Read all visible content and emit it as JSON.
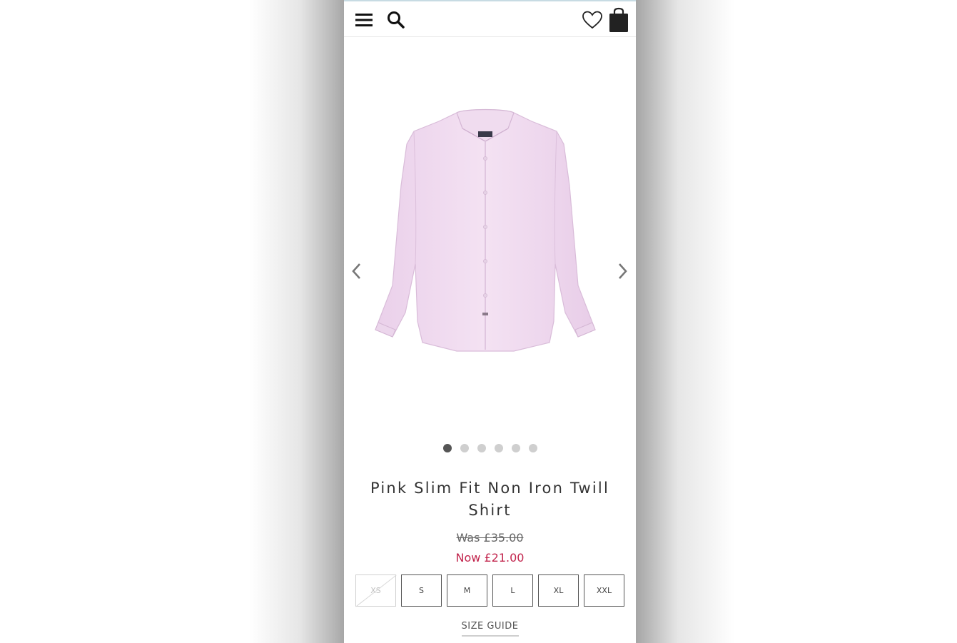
{
  "header": {
    "menu_icon": "hamburger-menu-icon",
    "search_icon": "search-icon",
    "wishlist_icon": "heart-icon",
    "bag_icon": "shopping-bag-icon"
  },
  "gallery": {
    "image_alt": "",
    "slide_count": 6,
    "active_slide": 1,
    "shirt_color": "#f1dcf1",
    "prev_icon": "chevron-left-icon",
    "next_icon": "chevron-right-icon"
  },
  "product": {
    "title": "Pink Slim Fit Non Iron Twill Shirt",
    "was_price": "Was £35.00",
    "now_price": "Now £21.00",
    "price_accent": "#c2254d"
  },
  "sizes": [
    {
      "label": "XS",
      "available": false
    },
    {
      "label": "S",
      "available": true
    },
    {
      "label": "M",
      "available": true
    },
    {
      "label": "L",
      "available": true
    },
    {
      "label": "XL",
      "available": true
    },
    {
      "label": "XXL",
      "available": true
    }
  ],
  "size_guide_label": "SIZE GUIDE"
}
